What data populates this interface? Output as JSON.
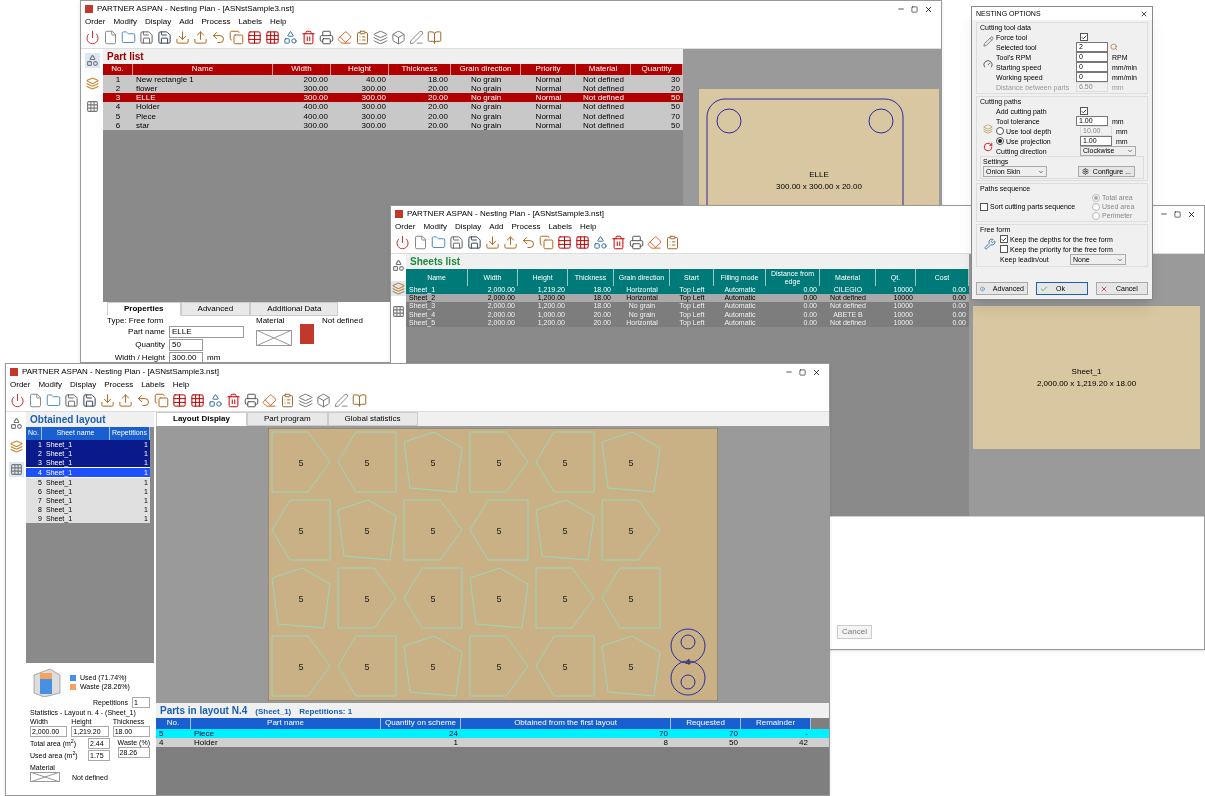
{
  "part_window": {
    "title": "PARTNER ASPAN - Nesting Plan - [ASNstSample3.nst]",
    "menu": [
      "Order",
      "Modify",
      "Display",
      "Add",
      "Process",
      "Labels",
      "Help"
    ],
    "part_list": {
      "title": "Part list",
      "columns": [
        "No.",
        "Name",
        "Width",
        "Height",
        "Thickness",
        "Grain direction",
        "Priority",
        "Material",
        "Quantity"
      ],
      "rows": [
        {
          "cells": [
            "1",
            "New rectangle 1",
            "200.00",
            "40.00",
            "18.00",
            "No grain",
            "Normal",
            "Not defined",
            "30"
          ],
          "selected": false
        },
        {
          "cells": [
            "2",
            "flower",
            "300.00",
            "300.00",
            "20.00",
            "No grain",
            "Normal",
            "Not defined",
            "20"
          ],
          "selected": false
        },
        {
          "cells": [
            "3",
            "ELLE",
            "300.00",
            "300.00",
            "20.00",
            "No grain",
            "Normal",
            "Not defined",
            "50"
          ],
          "selected": true
        },
        {
          "cells": [
            "4",
            "Holder",
            "400.00",
            "300.00",
            "20.00",
            "No grain",
            "Normal",
            "Not defined",
            "50"
          ],
          "selected": false
        },
        {
          "cells": [
            "5",
            "Piece",
            "400.00",
            "300.00",
            "20.00",
            "No grain",
            "Normal",
            "Not defined",
            "70"
          ],
          "selected": false
        },
        {
          "cells": [
            "6",
            "star",
            "300.00",
            "300.00",
            "20.00",
            "No grain",
            "Normal",
            "Not defined",
            "50"
          ],
          "selected": false
        }
      ]
    },
    "properties": {
      "tabs": [
        {
          "label": "Properties",
          "selected": true
        },
        {
          "label": "Advanced",
          "selected": false
        },
        {
          "label": "Additional Data",
          "selected": false
        }
      ],
      "type": "Type: Free form",
      "fields": [
        {
          "label": "Part name",
          "value": "ELLE"
        },
        {
          "label": "Quantity",
          "value": "50"
        },
        {
          "label": "Width / Height",
          "value": "300.00",
          "unit": "mm"
        }
      ],
      "material_label": "Material",
      "material_value": "Not defined"
    },
    "preview": {
      "name": "ELLE",
      "size": "300.00 x 300.00 x 20.00"
    }
  },
  "sheets_window": {
    "title": "PARTNER ASPAN - Nesting Plan - [ASNstSample3.nst]",
    "menu": [
      "Order",
      "Modify",
      "Display",
      "Add",
      "Process",
      "Labels",
      "Help"
    ],
    "sheets_list": {
      "title": "Sheets list",
      "columns": [
        "Name",
        "Width",
        "Height",
        "Thickness",
        "Grain direction",
        "Start",
        "Filling mode",
        "Distance from edge",
        "Material",
        "Qt.",
        "Cost"
      ],
      "rows": [
        {
          "cells": [
            "Sheet_1",
            "2,000.00",
            "1,219.20",
            "18.00",
            "Horizontal",
            "Top Left",
            "Automatic",
            "0.00",
            "CILEGIO",
            "10000",
            "0.00"
          ],
          "selected": true,
          "disabled": false
        },
        {
          "cells": [
            "Sheet_2",
            "2,000.00",
            "1,200.00",
            "18.00",
            "Horizontal",
            "Top Left",
            "Automatic",
            "0.00",
            "Not defined",
            "10000",
            "0.00"
          ],
          "selected": false,
          "disabled": false
        },
        {
          "cells": [
            "Sheet_3",
            "2,000.00",
            "1,200.00",
            "18.00",
            "No grain",
            "Top Left",
            "Automatic",
            "0.00",
            "Not defined",
            "10000",
            "0.00"
          ],
          "selected": false,
          "disabled": true
        },
        {
          "cells": [
            "Sheet_4",
            "2,000.00",
            "1,000.00",
            "20.00",
            "No grain",
            "Top Left",
            "Automatic",
            "0.00",
            "ABETE B",
            "10000",
            "0.00"
          ],
          "selected": false,
          "disabled": true
        },
        {
          "cells": [
            "Sheet_5",
            "2,000.00",
            "1,200.00",
            "20.00",
            "Horizontal",
            "Top Left",
            "Automatic",
            "0.00",
            "Not defined",
            "10000",
            "0.00"
          ],
          "selected": false,
          "disabled": true
        }
      ]
    },
    "preview": {
      "name": "Sheet_1",
      "size": "2,000.00 x 1,219.20 x 18.00"
    },
    "cancel": "Cancel"
  },
  "layout_window": {
    "title": "PARTNER ASPAN - Nesting Plan - [ASNstSample3.nst]",
    "menu": [
      "Order",
      "Modify",
      "Display",
      "Process",
      "Labels",
      "Help"
    ],
    "obtained": {
      "title": "Obtained layout",
      "columns": [
        "No.",
        "Sheet name",
        "Repetitions"
      ],
      "rows": [
        {
          "no": "1",
          "name": "Sheet_1",
          "reps": "1",
          "processed": true,
          "selected": false
        },
        {
          "no": "2",
          "name": "Sheet_1",
          "reps": "1",
          "processed": true,
          "selected": false
        },
        {
          "no": "3",
          "name": "Sheet_1",
          "reps": "1",
          "processed": true,
          "selected": false
        },
        {
          "no": "4",
          "name": "Sheet_1",
          "reps": "1",
          "processed": false,
          "selected": true
        },
        {
          "no": "5",
          "name": "Sheet_1",
          "reps": "1",
          "processed": false,
          "selected": false
        },
        {
          "no": "6",
          "name": "Sheet_1",
          "reps": "1",
          "processed": false,
          "selected": false
        },
        {
          "no": "7",
          "name": "Sheet_1",
          "reps": "1",
          "processed": false,
          "selected": false
        },
        {
          "no": "8",
          "name": "Sheet_1",
          "reps": "1",
          "processed": false,
          "selected": false
        },
        {
          "no": "9",
          "name": "Sheet_1",
          "reps": "1",
          "processed": false,
          "selected": false
        }
      ]
    },
    "tabs": [
      {
        "label": "Layout Display",
        "selected": true
      },
      {
        "label": "Part program",
        "selected": false
      },
      {
        "label": "Global statistics",
        "selected": false
      }
    ],
    "pieces": [
      {
        "label": "5",
        "kind": "polygon"
      },
      {
        "label": "5",
        "kind": "polygon"
      },
      {
        "label": "5",
        "kind": "polygon"
      },
      {
        "label": "5",
        "kind": "polygon"
      },
      {
        "label": "5",
        "kind": "polygon"
      },
      {
        "label": "5",
        "kind": "polygon"
      },
      {
        "label": "5",
        "kind": "polygon"
      },
      {
        "label": "5",
        "kind": "polygon"
      },
      {
        "label": "5",
        "kind": "polygon"
      },
      {
        "label": "5",
        "kind": "polygon"
      },
      {
        "label": "5",
        "kind": "polygon"
      },
      {
        "label": "5",
        "kind": "polygon"
      },
      {
        "label": "5",
        "kind": "polygon"
      },
      {
        "label": "5",
        "kind": "polygon"
      },
      {
        "label": "5",
        "kind": "polygon"
      },
      {
        "label": "5",
        "kind": "polygon"
      },
      {
        "label": "5",
        "kind": "polygon"
      },
      {
        "label": "5",
        "kind": "polygon"
      },
      {
        "label": "5",
        "kind": "polygon"
      },
      {
        "label": "5",
        "kind": "polygon"
      },
      {
        "label": "5",
        "kind": "polygon"
      },
      {
        "label": "5",
        "kind": "polygon"
      },
      {
        "label": "5",
        "kind": "polygon"
      },
      {
        "label": "5",
        "kind": "polygon"
      },
      {
        "label": "4",
        "kind": "holder"
      }
    ],
    "stats": {
      "legend": [
        {
          "label": "Used (71.74%)",
          "color": "#4a90e2"
        },
        {
          "label": "Waste (28.26%)",
          "color": "#f4a460"
        }
      ],
      "repetitions_label": "Repetitions",
      "repetitions": "1",
      "title": "Statistics - Layout n. 4 - (Sheet_1)",
      "fields": [
        {
          "label": "Width",
          "value": "2,000.00"
        },
        {
          "label": "Height",
          "value": "1,219.20"
        },
        {
          "label": "Thickness",
          "value": "18.00"
        }
      ],
      "areas": [
        {
          "label": "Total area (m$^{2}$)",
          "value": "2.44"
        },
        {
          "label": "Used area (m$^{2}$)",
          "value": "1.75"
        }
      ],
      "waste_label": "Waste (%)",
      "waste": "28.26",
      "material_label": "Material",
      "material_value": "Not defined"
    },
    "parts": {
      "title": "Parts in layout N.4",
      "sheet": "(Sheet_1)",
      "repetitions": "Repetitions: 1",
      "columns": [
        "No.",
        "Part name",
        "Quantity on scheme",
        "Obtained from the first layout",
        "Requested",
        "Remainder"
      ],
      "rows": [
        {
          "cells": [
            "5",
            "Piece",
            "24",
            "70",
            "70",
            "-"
          ],
          "selected": true
        },
        {
          "cells": [
            "4",
            "Holder",
            "1",
            "8",
            "50",
            "42"
          ],
          "selected": false
        }
      ]
    }
  },
  "dialog": {
    "title": "NESTING OPTIONS",
    "tool_group": {
      "title": "Cutting tool data",
      "rows": [
        {
          "kind": "check",
          "label": "Force tool",
          "checked": true
        },
        {
          "kind": "field",
          "label": "Selected tool",
          "value": "2",
          "picker": true
        },
        {
          "kind": "field",
          "label": "Tool's RPM",
          "value": "0",
          "unit": "RPM"
        },
        {
          "kind": "field",
          "label": "Starting speed",
          "value": "0",
          "unit": "mm/min"
        },
        {
          "kind": "field",
          "label": "Working speed",
          "value": "0",
          "unit": "mm/min"
        },
        {
          "kind": "field",
          "label": "Distance between parts",
          "value": "6.50",
          "unit": "mm",
          "disabled": true
        }
      ]
    },
    "path_group": {
      "title": "Cutting paths",
      "rows": [
        {
          "kind": "check",
          "label": "Add cutting path",
          "checked": true
        },
        {
          "kind": "field",
          "label": "Tool tolerance",
          "value": "1.00",
          "unit": "mm"
        },
        {
          "kind": "radio",
          "label": "Use tool depth",
          "selected": false,
          "value": "10.00",
          "unit": "mm",
          "disabled": true
        },
        {
          "kind": "radio",
          "label": "Use projection",
          "selected": true,
          "value": "1.00",
          "unit": "mm"
        },
        {
          "kind": "select",
          "label": "Cutting direction",
          "value": "Clockwise"
        }
      ],
      "settings": {
        "title": "Settings",
        "select": "Onion Skin",
        "button": "Configure ..."
      }
    },
    "sequence": {
      "title": "Paths sequence",
      "checkbox": {
        "label": "Sort cutting parts sequence",
        "checked": false
      },
      "options": [
        {
          "label": "Total area",
          "selected": true
        },
        {
          "label": "Used area",
          "selected": false
        },
        {
          "label": "Perimeter",
          "selected": false
        }
      ],
      "disabled": true
    },
    "free_form": {
      "title": "Free form",
      "checks": [
        {
          "label": "Keep the depths for the free form",
          "checked": true
        },
        {
          "label": "Keep the priority for the free form",
          "checked": false
        }
      ],
      "select": {
        "label": "Keep leadin/out",
        "value": "None"
      }
    },
    "buttons": [
      {
        "label": "Advanced",
        "kind": "info"
      },
      {
        "label": "Ok",
        "kind": "ok"
      },
      {
        "label": "Cancel",
        "kind": "cancel"
      }
    ]
  }
}
